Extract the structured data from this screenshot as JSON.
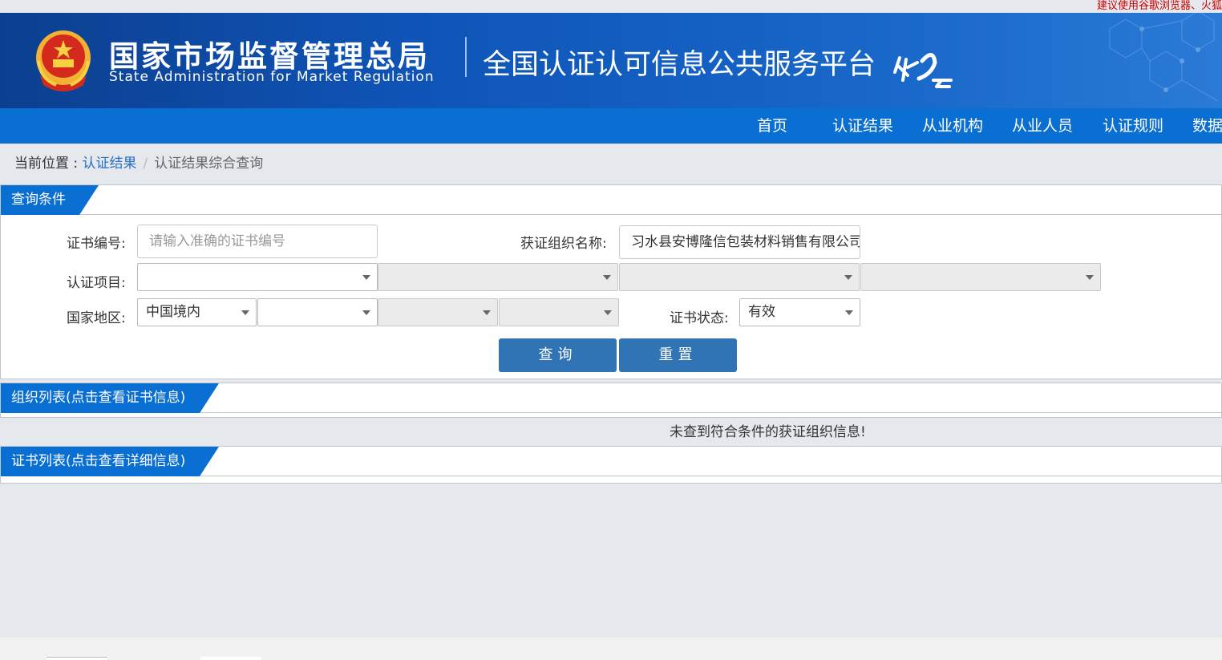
{
  "notice": "建议使用谷歌浏览器、火狐",
  "header": {
    "org_cn": "国家市场监督管理总局",
    "org_en": "State Administration  for  Market Regulation",
    "platform": "全国认证认可信息公共服务平台",
    "logo_text": "认e云"
  },
  "nav": {
    "items": [
      {
        "label": "首页"
      },
      {
        "label": "认证结果"
      },
      {
        "label": "从业机构"
      },
      {
        "label": "从业人员"
      },
      {
        "label": "认证规则"
      },
      {
        "label": "数据"
      }
    ]
  },
  "breadcrumb": {
    "prefix": "当前位置 : ",
    "link": "认证结果",
    "separator": "/",
    "current": "认证结果综合查询"
  },
  "query": {
    "title": "查询条件",
    "cert_no_label": "证书编号:",
    "cert_no_placeholder": "请输入准确的证书编号",
    "org_name_label": "获证组织名称:",
    "org_name_value": "习水县安博隆信包装材料销售有限公司",
    "project_label": "认证项目:",
    "region_label": "国家地区:",
    "region_value": "中国境内",
    "status_label": "证书状态:",
    "status_value": "有效",
    "search_button": "查询",
    "reset_button": "重置"
  },
  "org_list": {
    "title": "组织列表(点击查看证书信息)",
    "empty_message": "未查到符合条件的获证组织信息!"
  },
  "cert_list": {
    "title": "证书列表(点击查看详细信息)"
  },
  "colors": {
    "header_blue": "#0f55b8",
    "nav_blue": "#0a6fd2",
    "button_blue": "#3174b6",
    "link_blue": "#2a6fc4",
    "notice_red": "#cc0000"
  }
}
